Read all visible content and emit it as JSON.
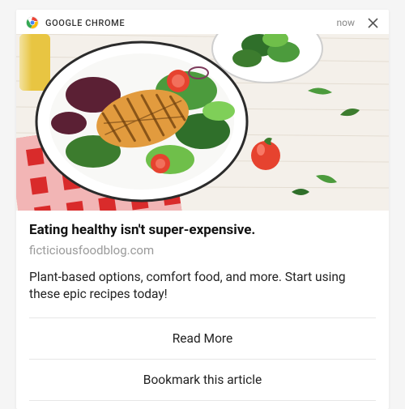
{
  "header": {
    "app_name": "GOOGLE CHROME",
    "time": "now"
  },
  "notification": {
    "title": "Eating healthy isn't super-expensive.",
    "source": "ficticiousfoodblog.com",
    "body": "Plant-based options, comfort food, and more. Start using these epic recipes today!"
  },
  "actions": {
    "primary": "Read More",
    "secondary": "Bookmark this article"
  }
}
